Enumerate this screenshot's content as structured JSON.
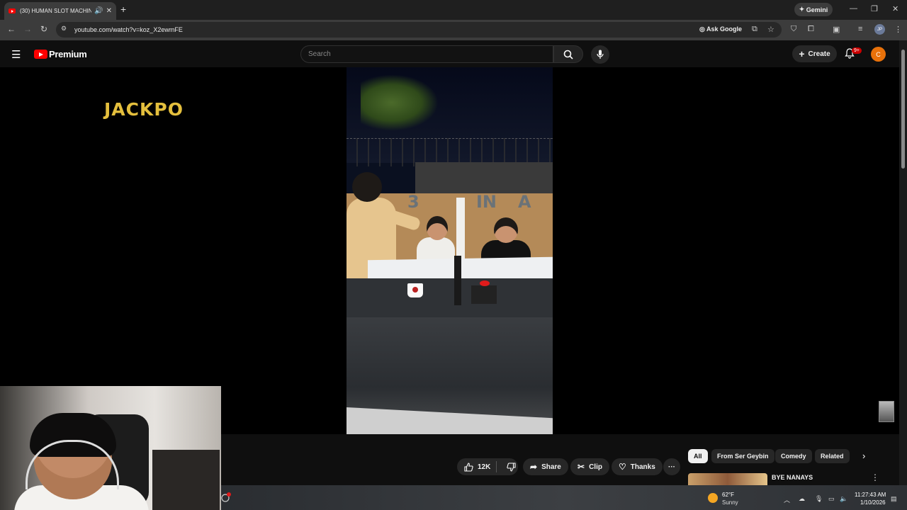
{
  "browser": {
    "tab_title": "(30) HUMAN SLOT MACHIN",
    "new_tab": "+",
    "gemini_label": "Gemini",
    "url": "youtube.com/watch?v=koz_X2ewmFE",
    "ask_google": "Ask Google",
    "profile_initials": "JP"
  },
  "youtube": {
    "logo_text": "Premium",
    "search_placeholder": "Search",
    "create_label": "Create",
    "notification_badge": "9+",
    "avatar_initial": "C"
  },
  "video": {
    "sign_text": "JACKPO",
    "banner_3": "3",
    "banner_in": "IN",
    "banner_a": "A"
  },
  "actions": {
    "like_count": "12K",
    "share": "Share",
    "clip": "Clip",
    "thanks": "Thanks",
    "more": "···"
  },
  "chips": [
    "All",
    "From Ser Geybin",
    "Comedy",
    "Related"
  ],
  "recommendation": {
    "title": "BYE NANAYS"
  },
  "taskbar": {
    "temperature": "62°F",
    "condition": "Sunny",
    "time": "11:27:43 AM",
    "date": "1/10/2026"
  },
  "colors": {
    "yt_red": "#ff0000",
    "avatar_orange": "#e8710a",
    "sign_gold": "#e4bf3d"
  }
}
